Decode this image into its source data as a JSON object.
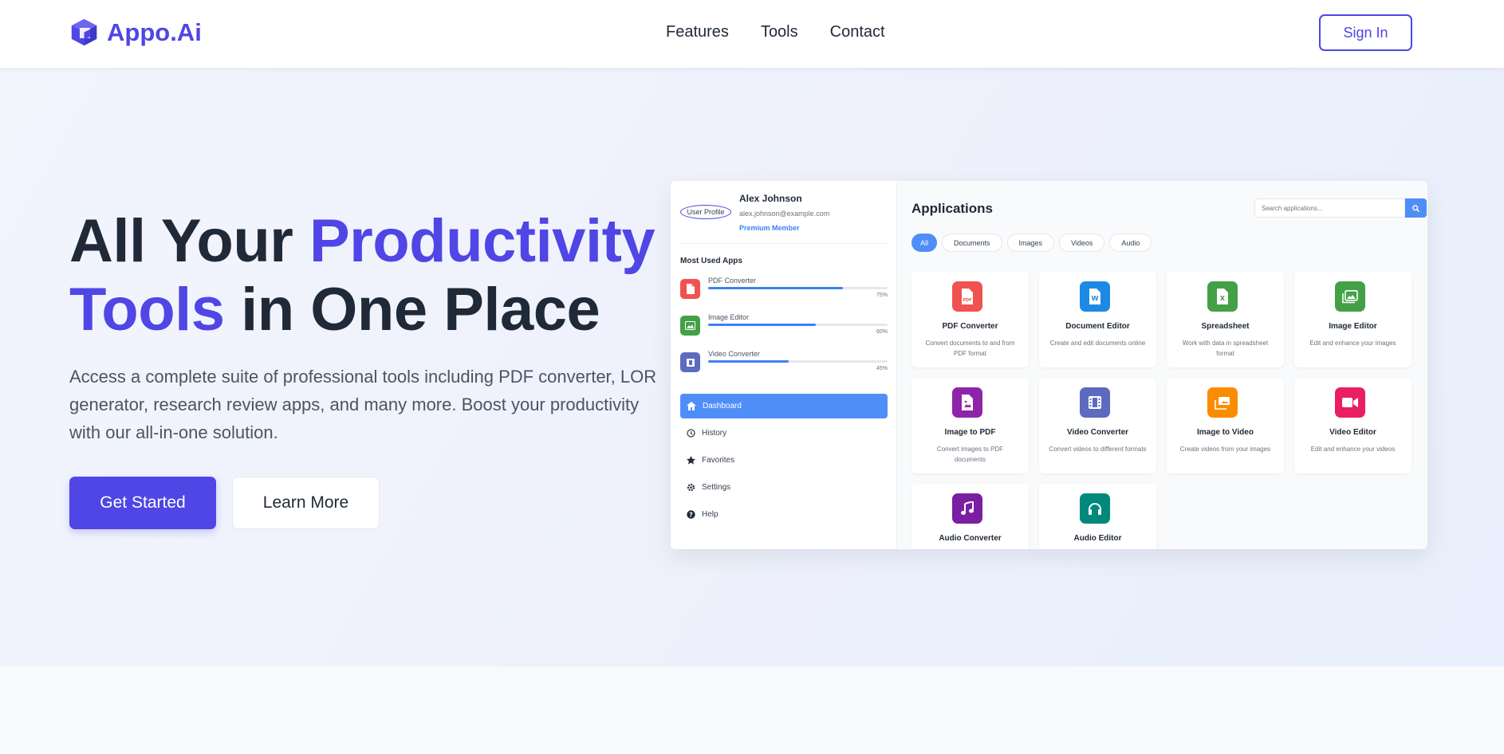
{
  "brand": {
    "name": "Appo.Ai",
    "color": "#4f46e5"
  },
  "nav": {
    "links": [
      "Features",
      "Tools",
      "Contact"
    ],
    "signin": "Sign In"
  },
  "hero": {
    "title_part1": "All Your ",
    "title_accent1": "Productivity",
    "title_accent2": "Tools",
    "title_part2": " in One Place",
    "description": "Access a complete suite of professional tools including PDF converter, LOR generator, research review apps, and many more. Boost your productivity with our all-in-one solution.",
    "primary_button": "Get Started",
    "secondary_button": "Learn More"
  },
  "mockup": {
    "profile": {
      "image_alt": "User Profile",
      "name": "Alex Johnson",
      "email": "alex.johnson@example.com",
      "badge": "Premium Member"
    },
    "most_used_title": "Most Used Apps",
    "most_used": [
      {
        "name": "PDF Converter",
        "percent": "75%",
        "progress": 0.75,
        "color": "#ef5350",
        "icon": "pdf-icon"
      },
      {
        "name": "Image Editor",
        "percent": "60%",
        "progress": 0.6,
        "color": "#43a047",
        "icon": "image-icon"
      },
      {
        "name": "Video Converter",
        "percent": "45%",
        "progress": 0.45,
        "color": "#5c6bc0",
        "icon": "film-icon"
      }
    ],
    "side_nav": [
      {
        "label": "Dashboard",
        "icon": "home-icon",
        "active": true
      },
      {
        "label": "History",
        "icon": "history-icon",
        "active": false
      },
      {
        "label": "Favorites",
        "icon": "star-icon",
        "active": false
      },
      {
        "label": "Settings",
        "icon": "gear-icon",
        "active": false
      },
      {
        "label": "Help",
        "icon": "help-icon",
        "active": false
      }
    ],
    "apps_title": "Applications",
    "search_placeholder": "Search applications...",
    "filters": [
      "All",
      "Documents",
      "Images",
      "Videos",
      "Audio"
    ],
    "apps": [
      {
        "name": "PDF Converter",
        "desc": "Convert documents to and from PDF format",
        "color": "#ef5350",
        "icon": "pdf-file-icon"
      },
      {
        "name": "Document Editor",
        "desc": "Create and edit documents online",
        "color": "#1e88e5",
        "icon": "word-file-icon"
      },
      {
        "name": "Spreadsheet",
        "desc": "Work with data in spreadsheet format",
        "color": "#43a047",
        "icon": "excel-file-icon"
      },
      {
        "name": "Image Editor",
        "desc": "Edit and enhance your images",
        "color": "#43a047",
        "icon": "images-icon"
      },
      {
        "name": "Image to PDF",
        "desc": "Convert images to PDF documents",
        "color": "#8e24aa",
        "icon": "image-file-icon"
      },
      {
        "name": "Video Converter",
        "desc": "Convert videos to different formats",
        "color": "#5c6bc0",
        "icon": "film-icon"
      },
      {
        "name": "Image to Video",
        "desc": "Create videos from your images",
        "color": "#fb8c00",
        "icon": "photo-video-icon"
      },
      {
        "name": "Video Editor",
        "desc": "Edit and enhance your videos",
        "color": "#e91e63",
        "icon": "video-camera-icon"
      },
      {
        "name": "Audio Converter",
        "desc": "",
        "color": "#7b1fa2",
        "icon": "music-icon"
      },
      {
        "name": "Audio Editor",
        "desc": "",
        "color": "#00897b",
        "icon": "headphones-icon"
      }
    ]
  }
}
